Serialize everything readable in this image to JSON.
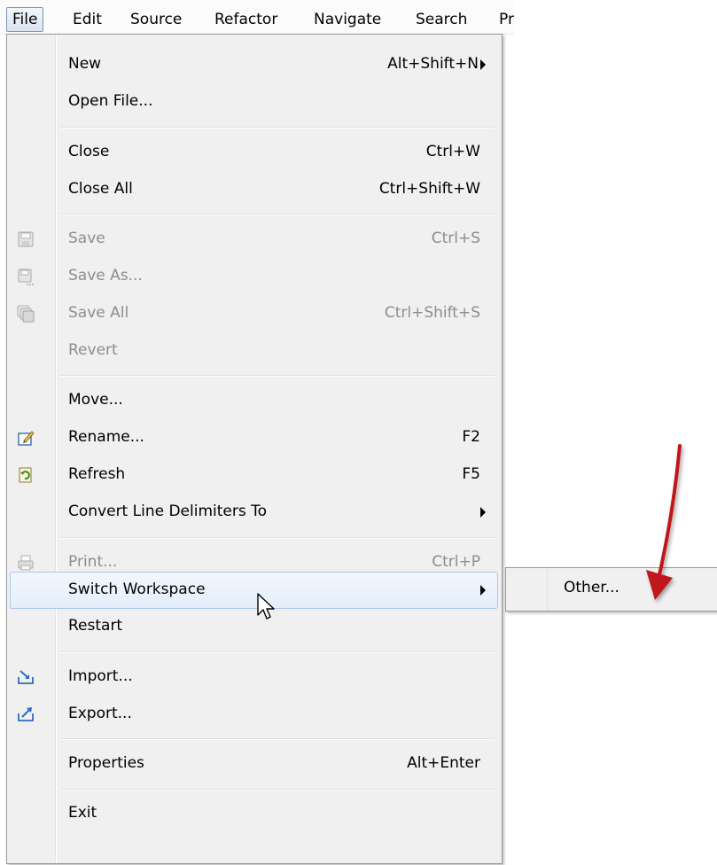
{
  "menubar": {
    "items": [
      "File",
      "Edit",
      "Source",
      "Refactor",
      "Navigate",
      "Search",
      "Pr"
    ]
  },
  "menu": {
    "new": {
      "label": "New",
      "shortcut": "Alt+Shift+N"
    },
    "open_file": {
      "label": "Open File..."
    },
    "close": {
      "label": "Close",
      "shortcut": "Ctrl+W"
    },
    "close_all": {
      "label": "Close All",
      "shortcut": "Ctrl+Shift+W"
    },
    "save": {
      "label": "Save",
      "shortcut": "Ctrl+S"
    },
    "save_as": {
      "label": "Save As..."
    },
    "save_all": {
      "label": "Save All",
      "shortcut": "Ctrl+Shift+S"
    },
    "revert": {
      "label": "Revert"
    },
    "move": {
      "label": "Move..."
    },
    "rename": {
      "label": "Rename...",
      "shortcut": "F2"
    },
    "refresh": {
      "label": "Refresh",
      "shortcut": "F5"
    },
    "convert": {
      "label": "Convert Line Delimiters To"
    },
    "print": {
      "label": "Print...",
      "shortcut": "Ctrl+P"
    },
    "switch_workspace": {
      "label": "Switch Workspace"
    },
    "restart": {
      "label": "Restart"
    },
    "import": {
      "label": "Import..."
    },
    "export": {
      "label": "Export..."
    },
    "properties": {
      "label": "Properties",
      "shortcut": "Alt+Enter"
    },
    "exit": {
      "label": "Exit"
    }
  },
  "submenu": {
    "other": {
      "label": "Other..."
    }
  },
  "icons": {
    "save": "save-icon",
    "save_as": "save-as-icon",
    "save_all": "save-all-icon",
    "rename": "rename-icon",
    "refresh": "refresh-icon",
    "print": "print-icon",
    "import": "import-icon",
    "export": "export-icon"
  },
  "colors": {
    "menu_bg": "#f0f0f0",
    "highlight_border": "#a8c8eb",
    "disabled_text": "#8d8d8d",
    "annotation_arrow": "#c0181b"
  }
}
